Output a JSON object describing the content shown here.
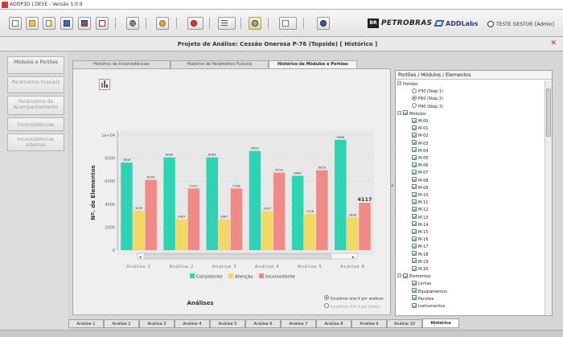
{
  "window": {
    "title": "ADDP3D | DESE - Versão 1.0.9"
  },
  "toolbar": {
    "brand_petrobras": "PETROBRAS",
    "brand_br": "BR",
    "brand_addlabs": "ADDLabs",
    "user": "TESTE GESTOR",
    "role": "[Admin]"
  },
  "project": {
    "title": "Projeto de Análise: Cessão Onerosa P-76 (Topside) [ Histórico ]"
  },
  "nav": [
    {
      "label": "Módulos e Portões"
    },
    {
      "label": "Parâmetros Fusíveis"
    },
    {
      "label": "Parâmetros de Acompanhamento"
    },
    {
      "label": "Inconsistências"
    },
    {
      "label": "Inconsistências Internas"
    }
  ],
  "tabs": [
    {
      "label": "Histórico de Inconsistências"
    },
    {
      "label": "Histórico de Parâmetros Fusíveis"
    },
    {
      "label": "Histórico de Módulos e Portões"
    }
  ],
  "chart_data": {
    "type": "bar",
    "categories": [
      "Análise 1",
      "Análise 2",
      "Análise 3",
      "Análise 4",
      "Análise 5",
      "Análise 6"
    ],
    "series": [
      {
        "name": "Consistente",
        "color": "#2fd3b4",
        "values": [
          7609,
          8064,
          8064,
          8624,
          6462,
          9586
        ]
      },
      {
        "name": "Atenção",
        "color": "#f3d867",
        "values": [
          3430,
          2687,
          2687,
          3397,
          3156,
          2846
        ]
      },
      {
        "name": "Inconsistente",
        "color": "#ef8a86",
        "values": [
          6102,
          5357,
          5358,
          6734,
          6950,
          4117
        ]
      }
    ],
    "xlabel": "Análises",
    "ylabel": "Nº. de Elementos",
    "ylim": [
      0,
      10000
    ],
    "yticks": [
      "0",
      "2000",
      "4000",
      "6000",
      "8000",
      "1e+04"
    ],
    "grid": true,
    "legend": "bottom",
    "radio_x_analysis": "Escalonar eixo X por análises",
    "radio_x_time": "Escalonar eixo X por tempo"
  },
  "tree": {
    "header": "Portões / Módulos / Elementos",
    "portoes_label": "Portões",
    "portoes": [
      "P30 (Step 1)",
      "P60 (Step 2)",
      "P90 (Step 3)"
    ],
    "modulos_label": "Módulos",
    "modulos": [
      "M-00",
      "M-01",
      "M-02",
      "M-03",
      "M-04",
      "M-05",
      "M-06",
      "M-07",
      "M-08",
      "M-09",
      "M-10",
      "M-11",
      "M-12",
      "M-13",
      "M-14",
      "M-15",
      "M-16",
      "M-17",
      "M-18",
      "M-19",
      "M-20"
    ],
    "elementos_label": "Elementos",
    "elementos": [
      "Linhas",
      "Equipamentos",
      "Pacotes",
      "Instrumentos"
    ]
  },
  "bottom_tabs": [
    "Análise 1",
    "Análise 2",
    "Análise 3",
    "Análise 4",
    "Análise 5",
    "Análise 6",
    "Análise 7",
    "Análise 8",
    "Análise 9",
    "Análise 10",
    "Histórico"
  ]
}
